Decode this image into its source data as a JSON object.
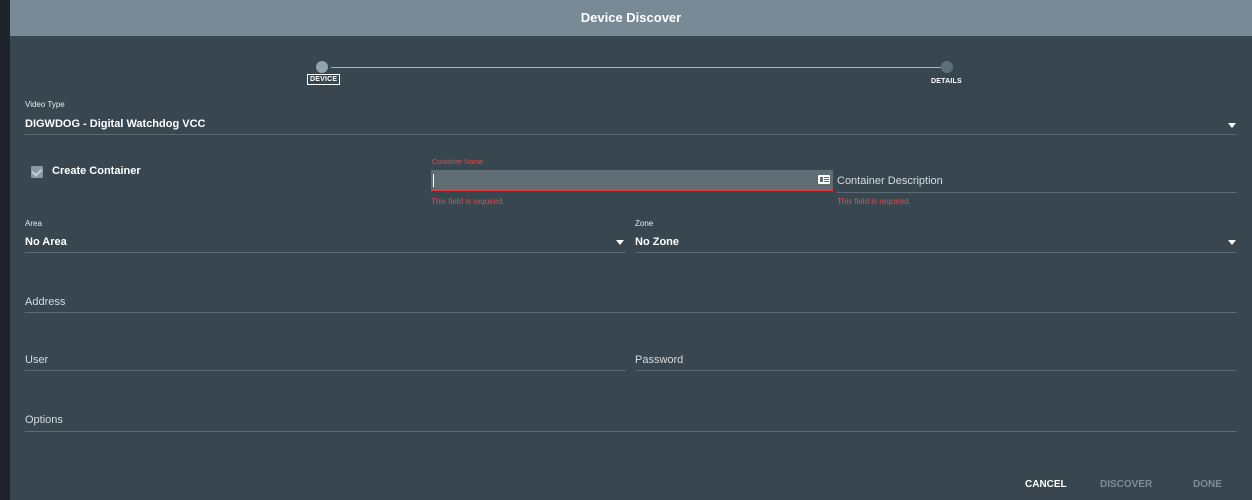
{
  "dialog": {
    "title": "Device Discover"
  },
  "stepper": {
    "steps": [
      {
        "label": "DEVICE",
        "active": true
      },
      {
        "label": "DETAILS",
        "active": false
      }
    ]
  },
  "video_type": {
    "label": "Video Type",
    "value": "DIGWDOG - Digital Watchdog VCC"
  },
  "create_container": {
    "label": "Create Container",
    "checked": true
  },
  "container_name": {
    "label": "Container Name",
    "value": "",
    "error": "This field is required."
  },
  "container_description": {
    "placeholder": "Container Description",
    "error": "This field is required."
  },
  "area": {
    "label": "Area",
    "value": "No Area"
  },
  "zone": {
    "label": "Zone",
    "value": "No Zone"
  },
  "address": {
    "placeholder": "Address"
  },
  "user": {
    "placeholder": "User"
  },
  "password": {
    "placeholder": "Password"
  },
  "options": {
    "placeholder": "Options"
  },
  "actions": {
    "cancel": "CANCEL",
    "discover": "DISCOVER",
    "done": "DONE"
  },
  "colors": {
    "titlebar": "#788a96",
    "dialog_bg": "#37464f",
    "error": "#e34b4b"
  }
}
